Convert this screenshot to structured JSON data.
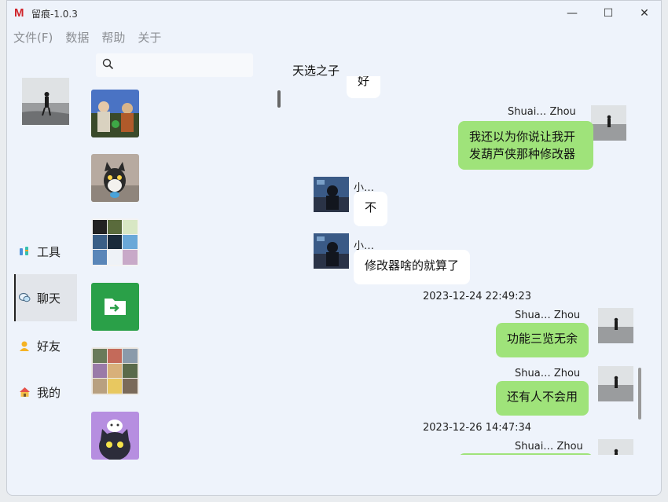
{
  "window": {
    "app_name": "留痕-1.0.3",
    "logo": "M"
  },
  "window_controls": {
    "minimize": "—",
    "maximize": "☐",
    "close": "✕"
  },
  "menu": [
    "文件(F)",
    "数据",
    "帮助",
    "关于"
  ],
  "nav": [
    {
      "label": "工具",
      "icon": "tools-icon"
    },
    {
      "label": "聊天",
      "icon": "chat-icon"
    },
    {
      "label": "好友",
      "icon": "friend-icon"
    },
    {
      "label": "我的",
      "icon": "home-icon"
    }
  ],
  "search": {
    "placeholder": ""
  },
  "chat": {
    "title": "天选之子"
  },
  "messages": {
    "m0_text": "好",
    "m1_name": "Shuai… Zhou",
    "m1_line1": "我还以为你说让我开",
    "m1_line2": "发葫芦侠那种修改器",
    "m2_name": "小…",
    "m2_text": "不",
    "m3_name": "小…",
    "m3_text": "修改器啥的就算了",
    "ts1": "2023-12-24 22:49:23",
    "m4_name": "Shua… Zhou",
    "m4_text": "功能三览无余",
    "m5_name": "Shua… Zhou",
    "m5_text": "还有人不会用",
    "ts2": "2023-12-26 14:47:34",
    "m6_name": "Shuai… Zhou"
  },
  "colors": {
    "my_bubble": "#9fe37a",
    "their_bubble": "#ffffff",
    "window_bg": "#eef3fb",
    "logo": "#d0242b"
  }
}
